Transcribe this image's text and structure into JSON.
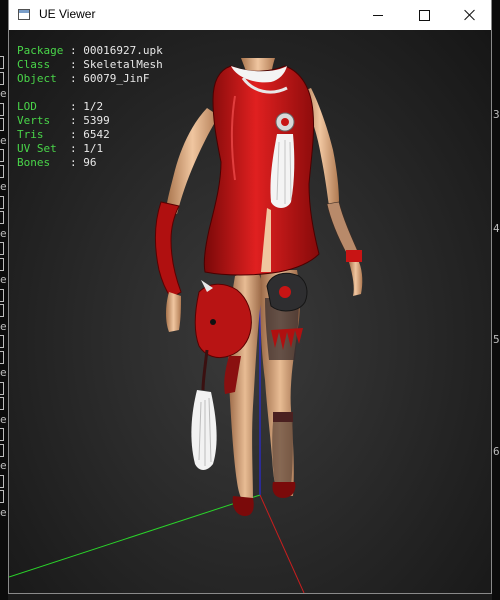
{
  "window": {
    "title": "UE Viewer"
  },
  "info": {
    "object_rows": [
      {
        "label": "Package",
        "value": "00016927.upk"
      },
      {
        "label": "Class",
        "value": "SkeletalMesh"
      },
      {
        "label": "Object",
        "value": "60079_JinF"
      }
    ],
    "mesh_rows": [
      {
        "label": "LOD",
        "value": "1/2"
      },
      {
        "label": "Verts",
        "value": "5399"
      },
      {
        "label": "Tris",
        "value": "6542"
      },
      {
        "label": "UV Set",
        "value": "1/1"
      },
      {
        "label": "Bones",
        "value": "96"
      }
    ]
  },
  "background_console": {
    "left_glyph": "e",
    "right_numbers": [
      "3",
      "4",
      "5",
      "6"
    ]
  },
  "colors": {
    "info_label": "#49d549",
    "info_value": "#e8e8e8",
    "axis_x": "#c81e1e",
    "axis_y": "#2ad42a",
    "axis_z": "#2a2adc",
    "dress": "#c81414",
    "skin": "#d8a880",
    "viewport_bg": "#2a2a2a"
  },
  "icons": {
    "app": "app-window-icon",
    "minimize": "minimize-icon",
    "maximize": "maximize-icon",
    "close": "close-icon"
  }
}
